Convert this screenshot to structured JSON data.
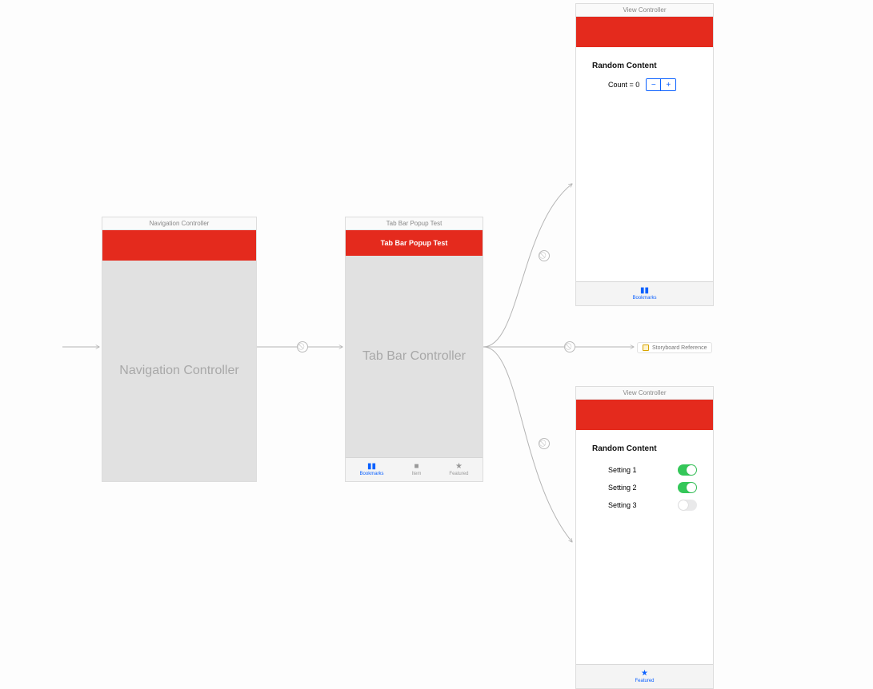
{
  "scenes": {
    "nav": {
      "header": "Navigation Controller",
      "placeholder": "Navigation Controller"
    },
    "tabbar": {
      "header": "Tab Bar Popup Test",
      "navTitle": "Tab Bar Popup Test",
      "placeholder": "Tab Bar Controller",
      "tabs": [
        {
          "label": "Bookmarks",
          "icon": "bookmarks"
        },
        {
          "label": "Item",
          "icon": "square"
        },
        {
          "label": "Featured",
          "icon": "star"
        }
      ]
    },
    "vc1": {
      "header": "View Controller",
      "contentTitle": "Random Content",
      "countLabel": "Count = 0",
      "tab": {
        "label": "Bookmarks",
        "icon": "bookmarks"
      }
    },
    "vc2": {
      "header": "View Controller",
      "contentTitle": "Random Content",
      "settings": [
        {
          "label": "Setting 1",
          "on": true
        },
        {
          "label": "Setting 2",
          "on": true
        },
        {
          "label": "Setting 3",
          "on": false
        }
      ],
      "tab": {
        "label": "Featured",
        "icon": "star"
      }
    },
    "storyboardRef": "Storyboard Reference"
  },
  "colors": {
    "accentRed": "#e42a1d",
    "tabActive": "#0a60ff",
    "switchOn": "#34c759"
  }
}
